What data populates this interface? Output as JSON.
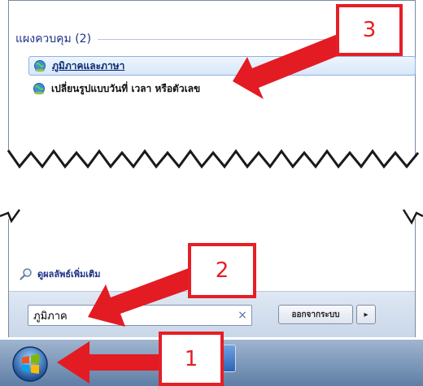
{
  "start_menu": {
    "section_title": "แผงควบคุม (2)",
    "results": [
      {
        "label": "ภูมิภาคและภาษา",
        "icon": "control-panel-globe-icon"
      },
      {
        "label": "เปลี่ยนรูปแบบวันที่ เวลา หรือตัวเลข",
        "icon": "control-panel-globe-icon"
      }
    ],
    "see_more_label": "ดูผลลัพธ์เพิ่มเติม",
    "search": {
      "value": "ภูมิภาค",
      "clear_symbol": "×"
    },
    "shutdown_label": "ออกจากระบบ",
    "shutdown_arrow": "▸"
  },
  "callouts": [
    "1",
    "2",
    "3"
  ],
  "colors": {
    "callout_red": "#e61e25",
    "arrow_red": "#e31b23",
    "section_title": "#1e3287",
    "selected_row": "#d7e7fa"
  }
}
